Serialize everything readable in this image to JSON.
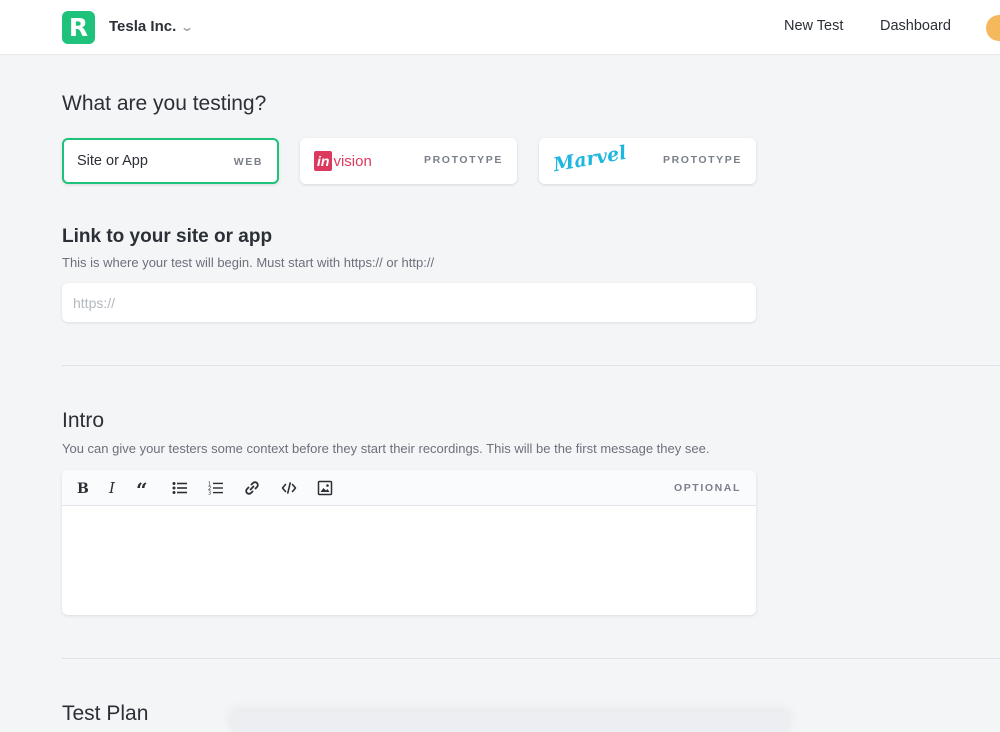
{
  "header": {
    "logo_letter": "R",
    "org_name": "Tesla Inc.",
    "nav": {
      "new_test": "New Test",
      "dashboard": "Dashboard"
    }
  },
  "testing": {
    "title": "What are you testing?",
    "options": [
      {
        "label": "Site or App",
        "tag": "WEB",
        "selected": true
      },
      {
        "logo_in": "in",
        "logo_rest": "vision",
        "tag": "PROTOTYPE",
        "selected": false
      },
      {
        "logo_text": "Marvel",
        "tag": "PROTOTYPE",
        "selected": false
      }
    ]
  },
  "link": {
    "title": "Link to your site or app",
    "subtitle": "This is where your test will begin. Must start with https:// or http://",
    "placeholder": "https://",
    "value": ""
  },
  "intro": {
    "title": "Intro",
    "subtitle": "You can give your testers some context before they start their recordings. This will be the first message they see.",
    "optional_label": "OPTIONAL",
    "content": ""
  },
  "test_plan": {
    "title": "Test Plan"
  },
  "colors": {
    "accent": "#1ec27a",
    "invision": "#dc395f",
    "marvel": "#1fb6e0"
  }
}
